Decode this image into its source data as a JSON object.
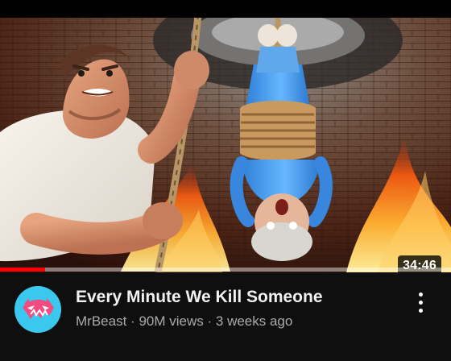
{
  "video": {
    "title": "Every Minute We Kill Someone",
    "channel": "MrBeast",
    "views": "90M views",
    "age": "3 weeks ago",
    "separator": "·",
    "duration": "34:46",
    "watched_fraction": 0.1
  },
  "icons": {
    "avatar": "mrbeast-logo-icon",
    "menu": "more-vertical-icon"
  },
  "colors": {
    "progress": "#ff0000",
    "avatar_bg": "#38c8f0",
    "title": "#f1f1f1",
    "secondary": "#aaaaaa"
  }
}
